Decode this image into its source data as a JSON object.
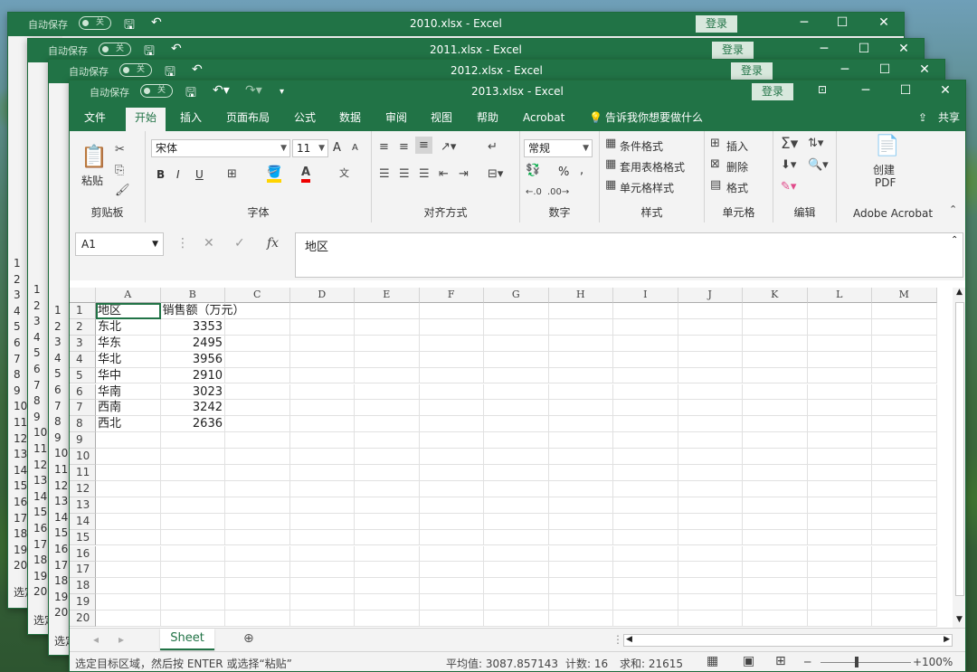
{
  "back_windows": [
    {
      "title": "2010.xlsx  -  Excel",
      "autosave": "自动保存",
      "toggle": "关",
      "login": "登录",
      "row_numbers": [
        "1",
        "2",
        "3",
        "4",
        "5",
        "6",
        "7",
        "8",
        "9",
        "10",
        "11",
        "12",
        "13",
        "14",
        "15",
        "16",
        "17",
        "18",
        "19",
        "20"
      ],
      "status": "选定"
    },
    {
      "title": "2011.xlsx  -  Excel",
      "autosave": "自动保存",
      "toggle": "关",
      "login": "登录",
      "row_numbers": [
        "1",
        "2",
        "3",
        "4",
        "5",
        "6",
        "7",
        "8",
        "9",
        "10",
        "11",
        "12",
        "13",
        "14",
        "15",
        "16",
        "17",
        "18",
        "19",
        "20"
      ],
      "status": "选定"
    },
    {
      "title": "2012.xlsx  -  Excel",
      "autosave": "自动保存",
      "toggle": "关",
      "login": "登录",
      "row_numbers": [
        "1",
        "2",
        "3",
        "4",
        "5",
        "6",
        "7",
        "8",
        "9",
        "10",
        "11",
        "12",
        "13",
        "14",
        "15",
        "16",
        "17",
        "18",
        "19",
        "20"
      ],
      "status": "选定"
    }
  ],
  "front": {
    "title": "2013.xlsx  -  Excel",
    "autosave": "自动保存",
    "toggle": "关",
    "login": "登录",
    "tabs": [
      "文件",
      "开始",
      "插入",
      "页面布局",
      "公式",
      "数据",
      "审阅",
      "视图",
      "帮助",
      "Acrobat"
    ],
    "tell_me": "告诉我你想要做什么",
    "share": "共享",
    "ribbon": {
      "clipboard": {
        "paste": "粘贴",
        "label": "剪贴板"
      },
      "font": {
        "name": "宋体",
        "size": "11",
        "label": "字体",
        "bold": "B",
        "italic": "I",
        "underline": "U",
        "grow": "A",
        "shrink": "A"
      },
      "alignment": {
        "label": "对齐方式"
      },
      "number": {
        "format": "常规",
        "label": "数字",
        "percent": "%",
        "comma": ","
      },
      "styles": {
        "cond": "条件格式",
        "table": "套用表格格式",
        "cell": "单元格样式",
        "label": "样式"
      },
      "cells": {
        "insert": "插入",
        "delete": "删除",
        "format": "格式",
        "label": "单元格"
      },
      "editing": {
        "label": "编辑"
      },
      "acrobat": {
        "create": "创建",
        "pdf": "PDF",
        "label": "Adobe Acrobat"
      }
    },
    "namebox": "A1",
    "formula": "地区",
    "columns": [
      "A",
      "B",
      "C",
      "D",
      "E",
      "F",
      "G",
      "H",
      "I",
      "J",
      "K",
      "L",
      "M"
    ],
    "rows": [
      "1",
      "2",
      "3",
      "4",
      "5",
      "6",
      "7",
      "8",
      "9",
      "10",
      "11",
      "12",
      "13",
      "14",
      "15",
      "16",
      "17",
      "18",
      "19",
      "20"
    ],
    "data": [
      [
        "地区",
        "销售额（万元）"
      ],
      [
        "东北",
        "3353"
      ],
      [
        "华东",
        "2495"
      ],
      [
        "华北",
        "3956"
      ],
      [
        "华中",
        "2910"
      ],
      [
        "华南",
        "3023"
      ],
      [
        "西南",
        "3242"
      ],
      [
        "西北",
        "2636"
      ]
    ],
    "sheet_tab": "Sheet",
    "status": {
      "message": "选定目标区域，然后按 ENTER 或选择“粘贴”",
      "average": "平均值: 3087.857143",
      "count": "计数: 16",
      "sum": "求和: 21615",
      "zoom": "100%"
    }
  }
}
